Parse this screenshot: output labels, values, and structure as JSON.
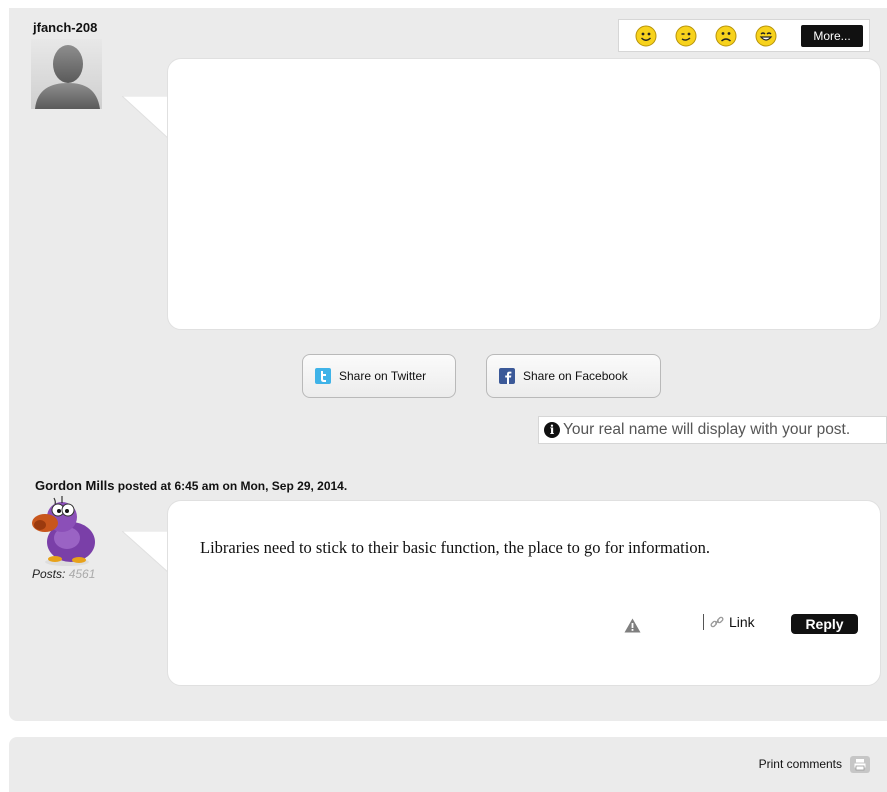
{
  "compose": {
    "username": "jfanch-208",
    "emoticons": [
      "smile-icon",
      "wink-icon",
      "sad-icon",
      "grin-icon"
    ],
    "more_label": "More...",
    "textarea_value": "",
    "share_twitter_label": "Share on Twitter",
    "share_facebook_label": "Share on Facebook",
    "notice_text": "Your real name will display with your post."
  },
  "comment": {
    "author": "Gordon Mills",
    "posted_text": " posted at 6:45 am on Mon, Sep 29, 2014.",
    "posts_label": "Posts:",
    "posts_count": "4561",
    "body": "Libraries need to stick to their basic function, the place to go for information.",
    "link_label": "Link",
    "reply_label": "Reply"
  },
  "footer": {
    "print_label": "Print comments"
  },
  "colors": {
    "panel": "#ebebeb",
    "emoticon_yellow": "#f7d21c",
    "twitter_blue": "#3fb3e8",
    "facebook_blue": "#3b5998",
    "dodo_purple": "#7a3fa8"
  }
}
